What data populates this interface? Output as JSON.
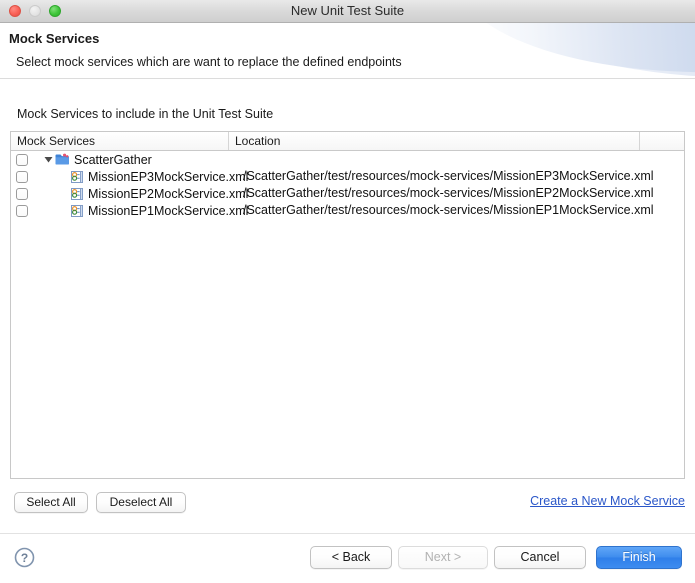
{
  "window": {
    "title": "New Unit Test Suite",
    "traffic_lights": [
      "close-button",
      "minimize-button",
      "zoom-button"
    ]
  },
  "header": {
    "title": "Mock Services",
    "subtitle": "Select mock services which are want to replace the defined endpoints"
  },
  "main": {
    "list_label": "Mock Services to include in the Unit Test Suite",
    "columns": [
      "Mock Services",
      "Location",
      ""
    ],
    "rows": [
      {
        "checked": false,
        "level": 0,
        "expanded": true,
        "icon": "project-folder-icon",
        "name": "ScatterGather",
        "location": ""
      },
      {
        "checked": false,
        "level": 1,
        "icon": "mock-service-file-icon",
        "name": "MissionEP3MockService.xml",
        "location": "/ScatterGather/test/resources/mock-services/MissionEP3MockService.xml"
      },
      {
        "checked": false,
        "level": 1,
        "icon": "mock-service-file-icon",
        "name": "MissionEP2MockService.xml",
        "location": "/ScatterGather/test/resources/mock-services/MissionEP2MockService.xml"
      },
      {
        "checked": false,
        "level": 1,
        "icon": "mock-service-file-icon",
        "name": "MissionEP1MockService.xml",
        "location": "/ScatterGather/test/resources/mock-services/MissionEP1MockService.xml"
      }
    ],
    "select_all_label": "Select All",
    "deselect_all_label": "Deselect All",
    "create_link_label": "Create a New Mock Service"
  },
  "footer": {
    "help_label": "?",
    "back_label": "< Back",
    "next_label": "Next >",
    "cancel_label": "Cancel",
    "finish_label": "Finish"
  },
  "colors": {
    "link": "#2b57c9",
    "finish_button": "#3f8dee",
    "close_light": "#fa6157",
    "zoom_light": "#3fc63a",
    "minimize_light": "#e4e4e4"
  }
}
